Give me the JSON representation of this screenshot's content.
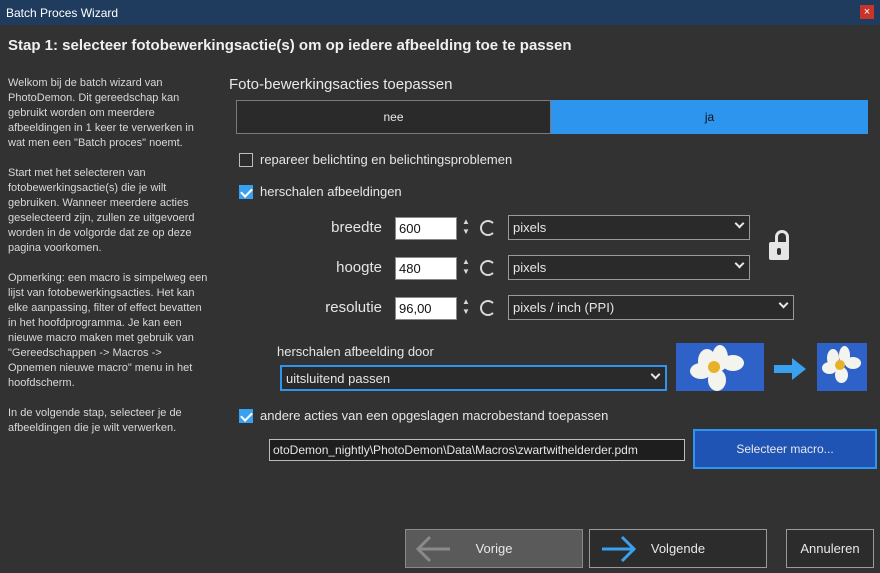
{
  "window": {
    "title": "Batch Proces Wizard",
    "close_label": "×"
  },
  "heading": "Stap 1: selecteer fotobewerkingsactie(s) om op iedere afbeelding toe te passen",
  "intro": {
    "p1": "Welkom bij de batch wizard van PhotoDemon. Dit gereedschap kan gebruikt worden om meerdere afbeeldingen in 1 keer te verwerken in wat men een \"Batch proces\" noemt.",
    "p2": "Start met het selecteren van fotobewerkingsactie(s) die je wilt gebruiken. Wanneer meerdere acties geselecteerd zijn, zullen ze uitgevoerd worden in de volgorde dat ze op deze pagina voorkomen.",
    "p3": "Opmerking: een macro is simpelweg een lijst van fotobewerkingsacties. Het kan elke aanpassing, filter of effect bevatten in het hoofdprogramma. Je kan een nieuwe macro maken met gebruik van \"Gereedschappen -> Macros -> Opnemen nieuwe macro\" menu in het hoofdscherm.",
    "p4": "In de volgende stap, selecteer je de afbeeldingen die je wilt verwerken."
  },
  "actions": {
    "title": "Foto-bewerkingsacties toepassen",
    "toggle": {
      "no": "nee",
      "yes": "ja",
      "selected": "ja"
    },
    "repair": {
      "label": "repareer belichting en belichtingsproblemen",
      "checked": false
    },
    "resize": {
      "label": "herschalen afbeeldingen",
      "checked": true
    },
    "width": {
      "label": "breedte",
      "value": "600",
      "unit": "pixels"
    },
    "height": {
      "label": "hoogte",
      "value": "480",
      "unit": "pixels"
    },
    "resolution": {
      "label": "resolutie",
      "value": "96,00",
      "unit": "pixels / inch (PPI)"
    },
    "fit": {
      "label": "herschalen afbeelding door",
      "value": "uitsluitend passen"
    },
    "macro": {
      "label": "andere acties van een opgeslagen macrobestand toepassen",
      "checked": true,
      "path": "otoDemon_nightly\\PhotoDemon\\Data\\Macros\\zwartwithelderder.pdm",
      "button": "Selecteer macro..."
    }
  },
  "footer": {
    "prev": "Vorige",
    "next": "Volgende",
    "cancel": "Annuleren"
  },
  "colors": {
    "accent": "#2d95ee",
    "titlebar": "#1f3c5e",
    "background": "#323232"
  }
}
